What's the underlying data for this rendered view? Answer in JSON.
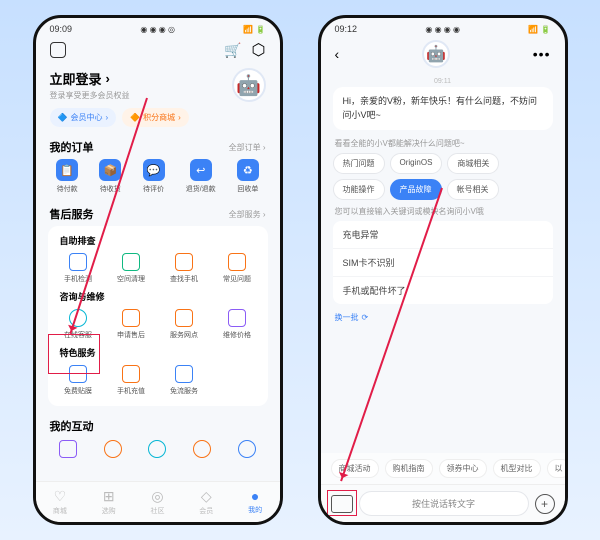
{
  "left": {
    "time": "09:09",
    "status_icons": "◉ ◉ ◉ ◎",
    "signal": "📶 🔋",
    "login": {
      "title": "立即登录",
      "sub": "登录享受更多会员权益"
    },
    "pills": {
      "member": "会员中心",
      "points": "积分商城"
    },
    "orders": {
      "title": "我的订单",
      "more": "全部订单 ›",
      "items": [
        {
          "icon": "📋",
          "label": "待付款"
        },
        {
          "icon": "📦",
          "label": "待收货"
        },
        {
          "icon": "💬",
          "label": "待评价"
        },
        {
          "icon": "↩",
          "label": "退货/退款"
        },
        {
          "icon": "♻",
          "label": "回收单"
        }
      ]
    },
    "service": {
      "title": "售后服务",
      "more": "全部服务 ›",
      "self": {
        "title": "自助排查",
        "items": [
          {
            "label": "手机检测"
          },
          {
            "label": "空间清理"
          },
          {
            "label": "查找手机"
          },
          {
            "label": "常见问题"
          }
        ]
      },
      "consult": {
        "title": "咨询与维修",
        "items": [
          {
            "label": "在线客服"
          },
          {
            "label": "申请售后"
          },
          {
            "label": "服务网点"
          },
          {
            "label": "维修价格"
          }
        ]
      },
      "special": {
        "title": "特色服务",
        "items": [
          {
            "label": "免费贴膜"
          },
          {
            "label": "手机充值"
          },
          {
            "label": "免流服务"
          }
        ]
      }
    },
    "interact": {
      "title": "我的互动"
    },
    "tabs": [
      {
        "icon": "♡",
        "label": "商城"
      },
      {
        "icon": "⊞",
        "label": "选购"
      },
      {
        "icon": "◎",
        "label": "社区"
      },
      {
        "icon": "◇",
        "label": "会员"
      },
      {
        "icon": "●",
        "label": "我的"
      }
    ]
  },
  "right": {
    "time": "09:12",
    "status_icons": "◉ ◉ ◉ ◉",
    "signal": "📶 🔋",
    "chat_time": "09:11",
    "greeting": "Hi，亲爱的V粉，新年快乐！有什么问题，不妨问问小V吧~",
    "hint1": "看看全能的小V都能解决什么问题吧~",
    "chips": [
      "热门问题",
      "OriginOS",
      "商城相关",
      "功能操作",
      "产品故障",
      "帐号相关"
    ],
    "active_chip": "产品故障",
    "hint2": "您可以直接输入关键词或模块名询问小V哦",
    "faq": [
      "充电异常",
      "SIM卡不识别",
      "手机或配件坏了"
    ],
    "refresh": "换一批",
    "quick": [
      "商城活动",
      "购机指南",
      "领券中心",
      "机型对比",
      "以"
    ],
    "input_placeholder": "按住说话转文字"
  }
}
